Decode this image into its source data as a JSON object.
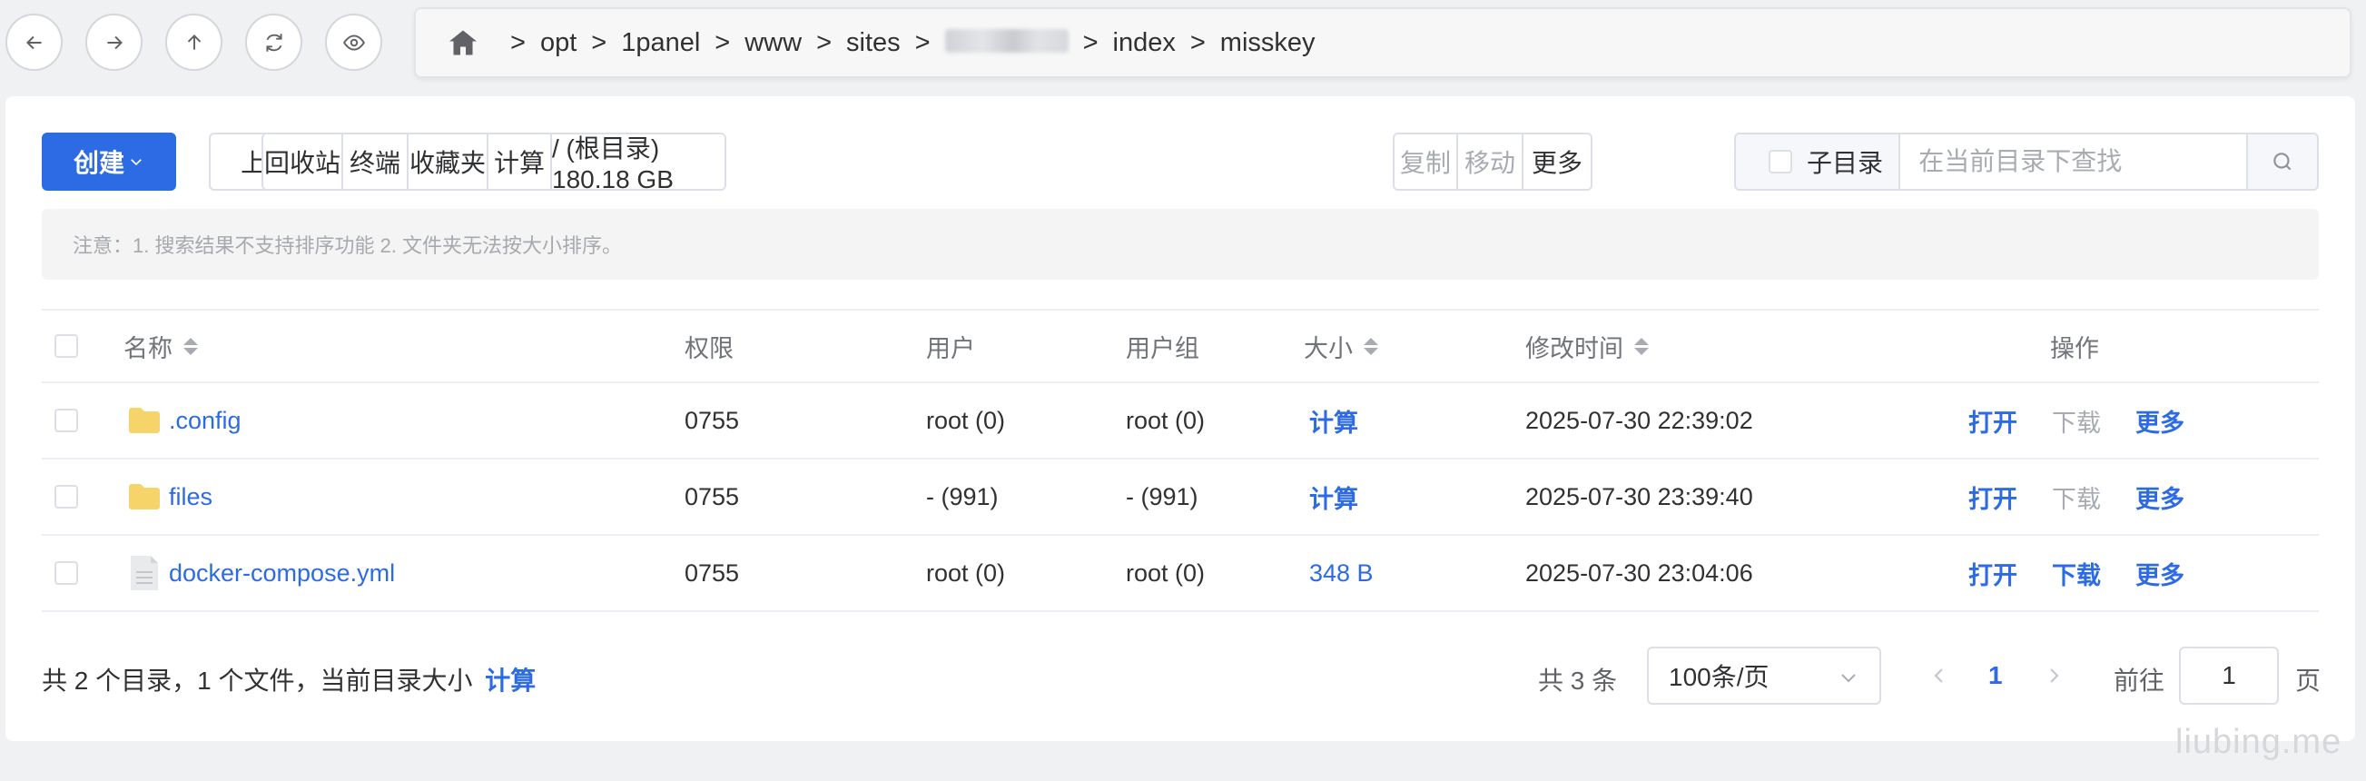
{
  "breadcrumb": {
    "segments": [
      "opt",
      "1panel",
      "www",
      "sites",
      "",
      "index",
      "misskey"
    ],
    "separator": ">"
  },
  "toolbar": {
    "create_label": "创建",
    "upload_label": "上传/下载",
    "recycle_label": "回收站",
    "terminal_label": "终端",
    "favorites_label": "收藏夹",
    "calc_label": "计算",
    "disk_label": "/ (根目录) 180.18 GB",
    "copy_label": "复制",
    "move_label": "移动",
    "more_label": "更多",
    "subdir_label": "子目录",
    "search_placeholder": "在当前目录下查找"
  },
  "notice": "注意：1. 搜索结果不支持排序功能 2. 文件夹无法按大小排序。",
  "table": {
    "headers": {
      "name": "名称",
      "perm": "权限",
      "user": "用户",
      "group": "用户组",
      "size": "大小",
      "mtime": "修改时间",
      "actions": "操作"
    },
    "rows": [
      {
        "type": "folder",
        "name": ".config",
        "perm": "0755",
        "user": "root (0)",
        "group": "root (0)",
        "size": "计算",
        "mtime": "2025-07-30 22:39:02",
        "open": "打开",
        "download": "下载",
        "more": "更多"
      },
      {
        "type": "folder",
        "name": "files",
        "perm": "0755",
        "user": "- (991)",
        "group": "- (991)",
        "size": "计算",
        "mtime": "2025-07-30 23:39:40",
        "open": "打开",
        "download": "下载",
        "more": "更多"
      },
      {
        "type": "file",
        "name": "docker-compose.yml",
        "perm": "0755",
        "user": "root (0)",
        "group": "root (0)",
        "size": "348 B",
        "mtime": "2025-07-30 23:04:06",
        "open": "打开",
        "download": "下载",
        "more": "更多"
      }
    ]
  },
  "footer": {
    "summary": "共 2 个目录，1 个文件，当前目录大小",
    "calc_link": "计算",
    "total": "共 3 条",
    "page_size": "100条/页",
    "current_page": "1",
    "goto_label": "前往",
    "goto_value": "1",
    "page_suffix": "页"
  },
  "watermark": "liubing.me",
  "colors": {
    "primary": "#2d6be4",
    "folder": "#f7d46a",
    "muted": "#a8abb2"
  }
}
